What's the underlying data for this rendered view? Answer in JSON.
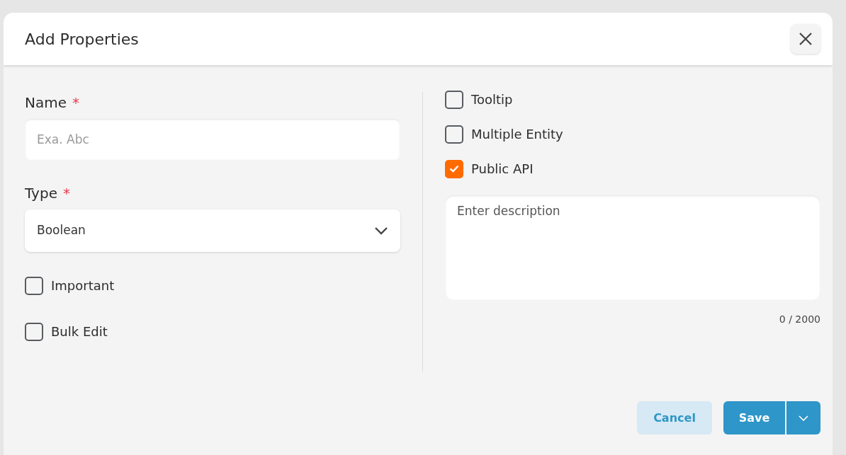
{
  "dialog": {
    "title": "Add Properties"
  },
  "name_field": {
    "label": "Name",
    "required_mark": "*",
    "placeholder": "Exa. Abc"
  },
  "type_field": {
    "label": "Type",
    "required_mark": "*",
    "value": "Boolean"
  },
  "left_checkboxes": [
    {
      "label": "Important",
      "checked": false
    },
    {
      "label": "Bulk Edit",
      "checked": false
    }
  ],
  "right_checkboxes": [
    {
      "label": "Tooltip",
      "checked": false
    },
    {
      "label": "Multiple Entity",
      "checked": false
    },
    {
      "label": "Public API",
      "checked": true
    }
  ],
  "description": {
    "placeholder": "Enter description",
    "counter": "0 / 2000"
  },
  "buttons": {
    "cancel": "Cancel",
    "save": "Save"
  }
}
